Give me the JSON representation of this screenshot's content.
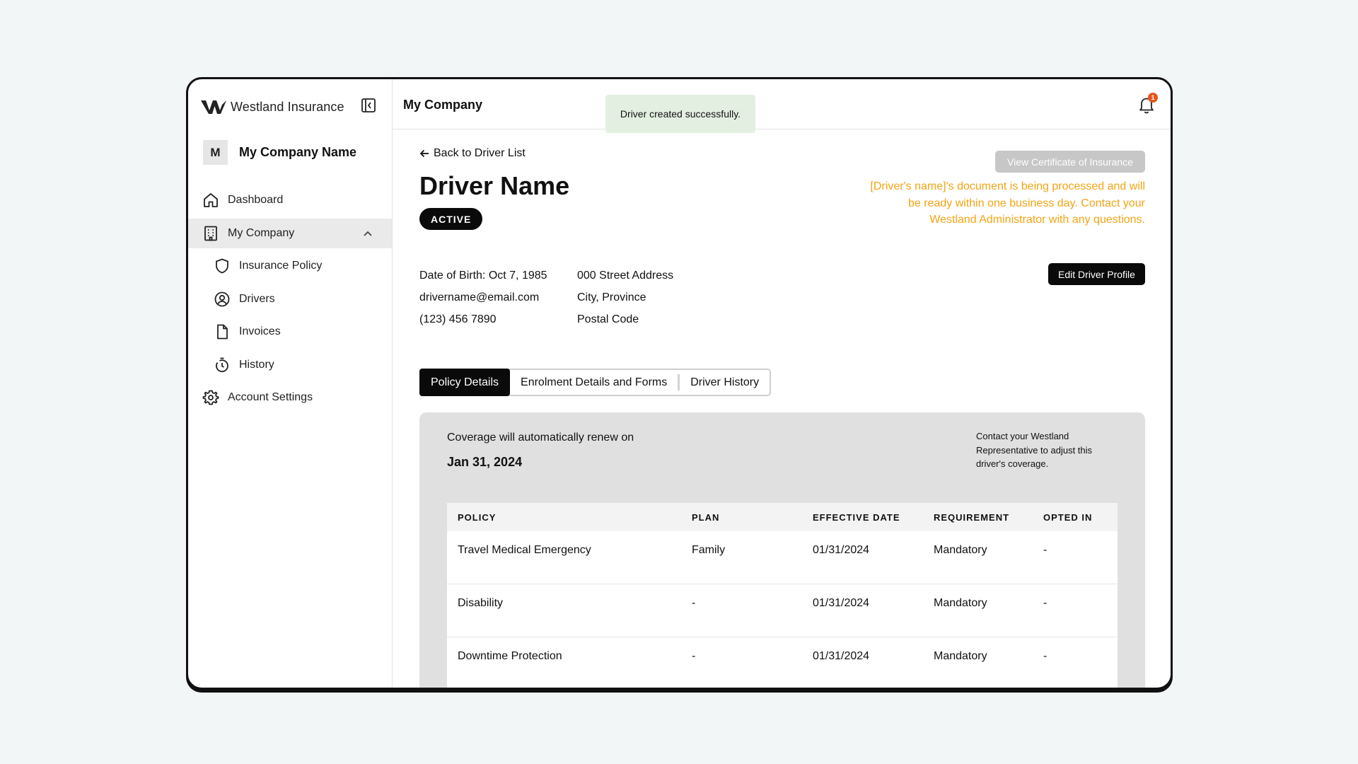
{
  "app": {
    "brand": "Westland Insurance",
    "company_initial": "M",
    "company_name": "My Company Name"
  },
  "sidebar": {
    "items": [
      {
        "label": "Dashboard",
        "icon": "home-icon"
      },
      {
        "label": "My Company",
        "icon": "building-icon",
        "expanded": true
      },
      {
        "label": "Insurance Policy",
        "icon": "shield-icon"
      },
      {
        "label": "Drivers",
        "icon": "user-circle-icon"
      },
      {
        "label": "Invoices",
        "icon": "file-icon"
      },
      {
        "label": "History",
        "icon": "timer-icon"
      },
      {
        "label": "Account Settings",
        "icon": "gear-icon"
      }
    ]
  },
  "topbar": {
    "title": "My Company",
    "notification_count": "1"
  },
  "toast": {
    "message": "Driver created successfully."
  },
  "driver": {
    "back_label": "Back to Driver List",
    "name": "Driver Name",
    "status": "ACTIVE",
    "dob": "Date of Birth: Oct 7, 1985",
    "email": "drivername@email.com",
    "phone": "(123) 456 7890",
    "address_line1": "000 Street Address",
    "address_line2": "City, Province",
    "address_line3": "Postal Code",
    "cert_button": "View Certificate of Insurance",
    "processing_note": "[Driver's name]'s document is being processed and will be ready within one business day. Contact your Westland Administrator with any questions.",
    "edit_button": "Edit Driver Profile"
  },
  "tabs": [
    {
      "label": "Policy Details",
      "active": true
    },
    {
      "label": "Enrolment Details and Forms",
      "active": false
    },
    {
      "label": "Driver History",
      "active": false
    }
  ],
  "coverage": {
    "renew_label": "Coverage will automatically renew on",
    "renew_date": "Jan 31, 2024",
    "contact_note": "Contact your Westland Representative to adjust this driver's coverage."
  },
  "policy_table": {
    "headers": [
      "POLICY",
      "PLAN",
      "EFFECTIVE DATE",
      "REQUIREMENT",
      "OPTED IN"
    ],
    "rows": [
      [
        "Travel Medical Emergency",
        "Family",
        "01/31/2024",
        "Mandatory",
        "-"
      ],
      [
        "Disability",
        "-",
        "01/31/2024",
        "Mandatory",
        "-"
      ],
      [
        "Downtime Protection",
        "-",
        "01/31/2024",
        "Mandatory",
        "-"
      ]
    ]
  },
  "colors": {
    "accent_dark": "#0a0a0a",
    "warning_text": "#f2a415",
    "toast_bg": "#e3efe1",
    "badge": "#e8541a"
  }
}
